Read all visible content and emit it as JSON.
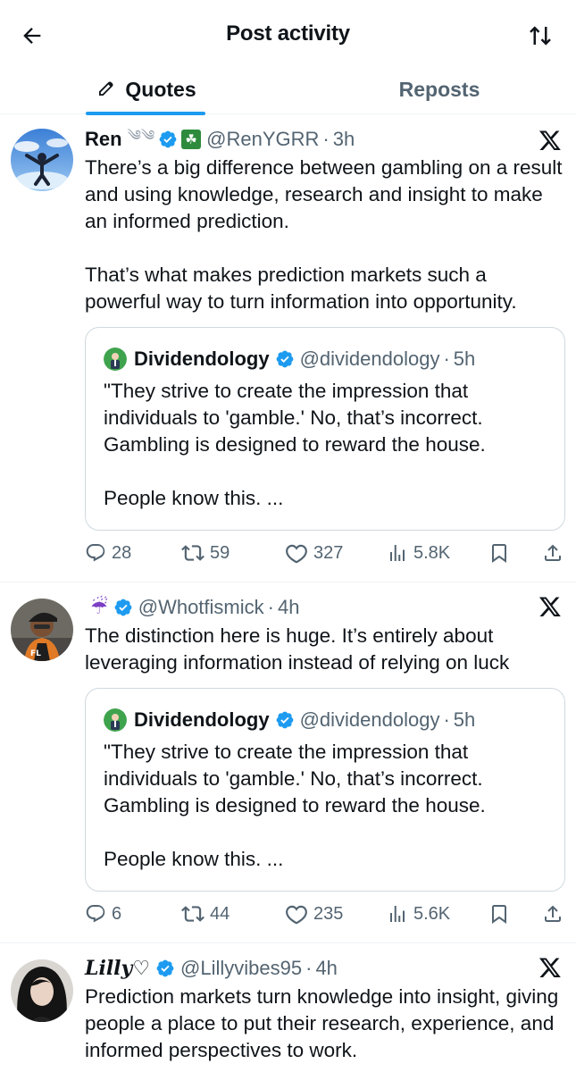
{
  "header": {
    "title": "Post activity",
    "back_icon": "arrow-left-icon",
    "sort_icon": "sort-arrows-icon"
  },
  "tabs": [
    {
      "label": "Quotes",
      "icon": "pencil-icon",
      "active": true
    },
    {
      "label": "Reposts",
      "active": false
    }
  ],
  "colors": {
    "accent": "#1d9bf0",
    "muted": "#536471",
    "border": "#cfd9de",
    "text": "#0f1419"
  },
  "posts": [
    {
      "name": "Ren",
      "verified": true,
      "handle": "@RenYGRR",
      "time": "3h",
      "text": "There’s a big difference between gambling on a result and using knowledge, research and insight to make an informed prediction.\n\nThat’s what makes prediction markets such a powerful way to turn information into opportunity.",
      "quote": {
        "name": "Dividendology",
        "handle": "@dividendology",
        "time": "5h",
        "text": "\"They strive to create the impression that individuals to 'gamble.' No, that’s incorrect. Gambling is designed to reward the house.\n\nPeople know this. ..."
      },
      "stats": {
        "replies": "28",
        "reposts": "59",
        "likes": "327",
        "views": "5.8K"
      }
    },
    {
      "name": "",
      "verified": true,
      "handle": "@Whotfismick",
      "time": "4h",
      "text": "The distinction here is huge. It’s entirely about leveraging information instead of relying on luck",
      "quote": {
        "name": "Dividendology",
        "handle": "@dividendology",
        "time": "5h",
        "text": "\"They strive to create the impression that individuals to 'gamble.' No, that’s incorrect. Gambling is designed to reward the house.\n\nPeople know this. ..."
      },
      "stats": {
        "replies": "6",
        "reposts": "44",
        "likes": "235",
        "views": "5.6K"
      }
    },
    {
      "name": "Lilly♡",
      "verified": true,
      "handle": "@Lillyvibes95",
      "time": "4h",
      "text": "Prediction markets turn knowledge into insight, giving people a place to put their research, experience, and informed perspectives to work."
    }
  ]
}
